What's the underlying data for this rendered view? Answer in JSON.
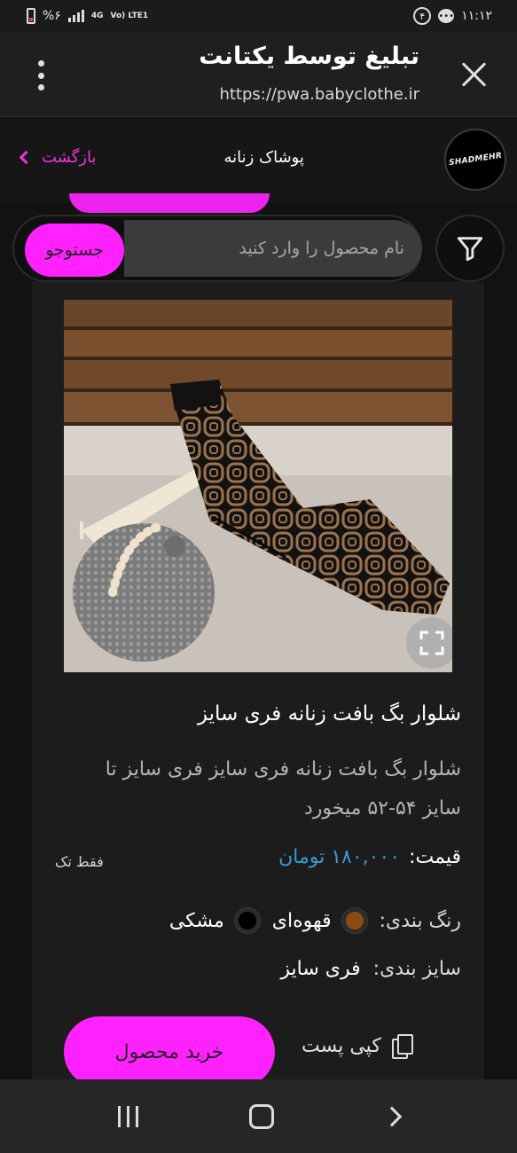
{
  "status_bar": {
    "time": "۱۱:۱۲",
    "notification_count": "۴",
    "battery_percent": "%۶",
    "network_label": "4G",
    "volte_label": "Vo) LTE1"
  },
  "browser": {
    "title": "تبلیغ توسط یکتانت",
    "url": "https://pwa.babyclothe.ir"
  },
  "site_header": {
    "logo_text": "SHADMEHR",
    "page_title": "پوشاک زنانه",
    "back_label": "بازگشت"
  },
  "search": {
    "placeholder": "نام محصول را وارد کنید",
    "value": "",
    "button_label": "جستوجو"
  },
  "product": {
    "name": "شلوار بگ بافت زنانه فری سایز",
    "description": "شلوار بگ بافت زنانه فری سایز فری سایز تا سایز ۵۴-۵۲ میخورد",
    "price_label": "قیمت:",
    "price_value": "۱۸۰,۰۰۰ تومان",
    "stock_badge": "فقط تک",
    "colors_label": "رنگ بندی:",
    "colors": [
      {
        "name": "قهوه‌ای",
        "hex": "#8a4a12"
      },
      {
        "name": "مشکی",
        "hex": "#000000"
      }
    ],
    "sizes_label": "سایز بندی:",
    "size_value": "فری سایز",
    "buy_label": "خرید محصول",
    "copy_label": "کپی پست"
  },
  "colors": {
    "accent": "#ff22ff",
    "price": "#3a9ad9",
    "back_link": "#ee33dd"
  }
}
